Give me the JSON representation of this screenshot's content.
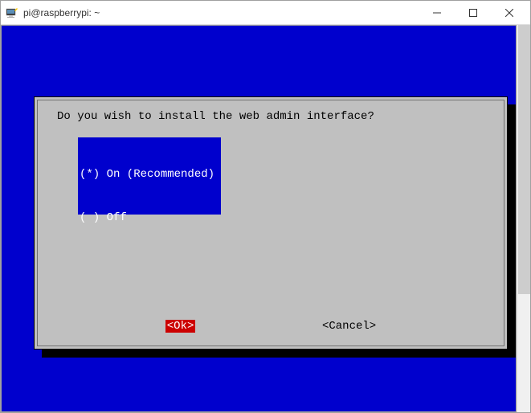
{
  "window": {
    "title": "pi@raspberrypi: ~"
  },
  "dialog": {
    "question": "Do you wish to install the web admin interface?",
    "options": [
      "(*) On (Recommended)",
      "( ) Off"
    ],
    "ok_label": "<Ok>",
    "cancel_label": "<Cancel>"
  }
}
